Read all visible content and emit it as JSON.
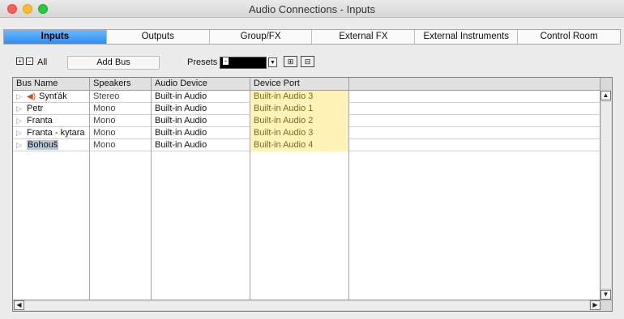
{
  "window": {
    "title": "Audio Connections - Inputs"
  },
  "tabs": [
    {
      "label": "Inputs",
      "active": true
    },
    {
      "label": "Outputs",
      "active": false
    },
    {
      "label": "Group/FX",
      "active": false
    },
    {
      "label": "External FX",
      "active": false
    },
    {
      "label": "External Instruments",
      "active": false
    },
    {
      "label": "Control Room",
      "active": false
    }
  ],
  "toolbar": {
    "all_label": "All",
    "add_bus_label": "Add Bus",
    "presets_label": "Presets",
    "presets_value": "-"
  },
  "table": {
    "columns": [
      "Bus Name",
      "Speakers",
      "Audio Device",
      "Device Port"
    ],
    "rows": [
      {
        "name": "Synťák",
        "speakers": "Stereo",
        "device": "Built-in Audio",
        "port": "Built-in Audio 3",
        "icon": "speaker-icon"
      },
      {
        "name": "Petr",
        "speakers": "Mono",
        "device": "Built-in Audio",
        "port": "Built-in Audio 1"
      },
      {
        "name": "Franta",
        "speakers": "Mono",
        "device": "Built-in Audio",
        "port": "Built-in Audio 2"
      },
      {
        "name": "Franta - kytara",
        "speakers": "Mono",
        "device": "Built-in Audio",
        "port": "Built-in Audio 3"
      },
      {
        "name": "Bohouš",
        "speakers": "Mono",
        "device": "Built-in Audio",
        "port": "Built-in Audio 4",
        "selected": true
      }
    ]
  },
  "colors": {
    "active_tab": "#2f8ef0",
    "port_cell_bg": "#fff3b8",
    "speaker_icon": "#d24a1a"
  }
}
